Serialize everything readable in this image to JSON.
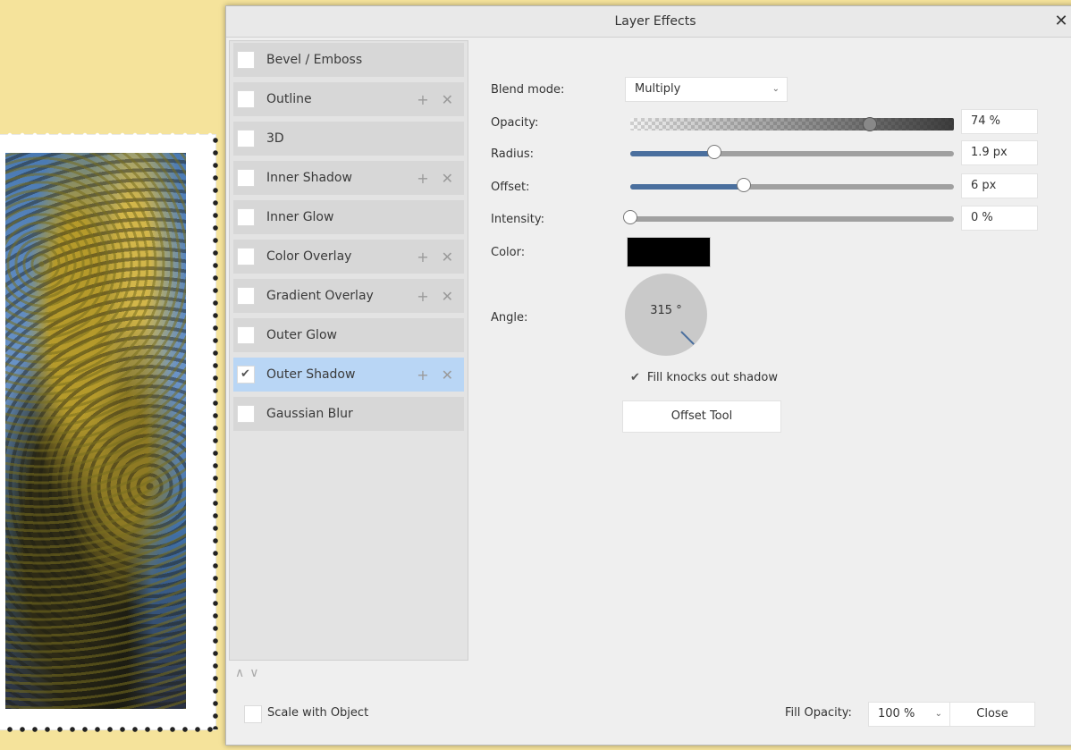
{
  "window": {
    "title": "Layer Effects",
    "close_glyph": "✕"
  },
  "effects": [
    {
      "label": "Bevel / Emboss",
      "checked": false,
      "actions": false
    },
    {
      "label": "Outline",
      "checked": false,
      "actions": true
    },
    {
      "label": "3D",
      "checked": false,
      "actions": false
    },
    {
      "label": "Inner Shadow",
      "checked": false,
      "actions": true
    },
    {
      "label": "Inner Glow",
      "checked": false,
      "actions": false
    },
    {
      "label": "Color Overlay",
      "checked": false,
      "actions": true
    },
    {
      "label": "Gradient Overlay",
      "checked": false,
      "actions": true
    },
    {
      "label": "Outer Glow",
      "checked": false,
      "actions": false
    },
    {
      "label": "Outer Shadow",
      "checked": true,
      "actions": true,
      "selected": true
    },
    {
      "label": "Gaussian Blur",
      "checked": false,
      "actions": false
    }
  ],
  "icons": {
    "add": "+",
    "remove": "✕",
    "check": "✔",
    "up": "∧",
    "down": "∨",
    "chevron": "⌄"
  },
  "settings": {
    "blend_mode_label": "Blend mode:",
    "blend_mode_value": "Multiply",
    "opacity_label": "Opacity:",
    "opacity_value": "74 %",
    "opacity_level": 0.74,
    "radius_label": "Radius:",
    "radius_value": "1.9 px",
    "radius_level": 0.26,
    "offset_label": "Offset:",
    "offset_value": "6 px",
    "offset_level": 0.35,
    "intensity_label": "Intensity:",
    "intensity_value": "0 %",
    "intensity_level": 0,
    "color_label": "Color:",
    "color_value": "#000000",
    "angle_label": "Angle:",
    "angle_value": "315 °",
    "knock_out_label": "Fill knocks out shadow",
    "knock_out_checked": true,
    "offset_tool_label": "Offset Tool"
  },
  "footer": {
    "scale_label": "Scale with Object",
    "fill_opacity_label": "Fill Opacity:",
    "fill_opacity_value": "100 %",
    "close_label": "Close"
  },
  "colors": {
    "accent": "#4a6f9e",
    "selected_row": "#b9d6f5",
    "background": "#f5e39b"
  }
}
